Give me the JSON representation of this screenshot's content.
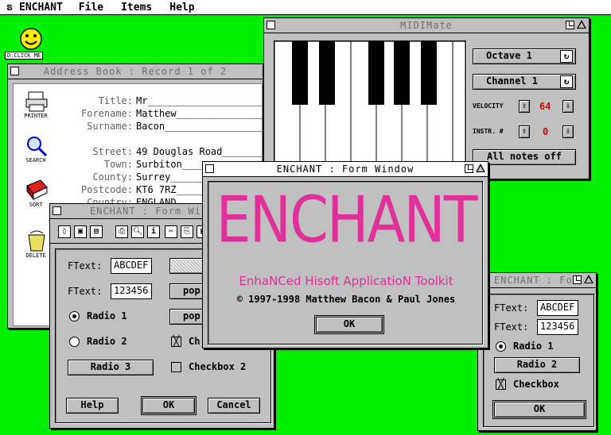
{
  "menubar": {
    "app": "ENCHANT",
    "items": [
      "File",
      "Items",
      "Help"
    ]
  },
  "desktop": {
    "icon_label": "D.CLICK ME"
  },
  "address_book": {
    "title": "Address Book : Record 1 of 2",
    "side_icons": [
      "PRINTER",
      "SEARCH",
      "SORT",
      "DELETE"
    ],
    "fields": [
      {
        "label": "Title:",
        "value": "Mr_______________________"
      },
      {
        "label": "Forename:",
        "value": "Matthew___________________"
      },
      {
        "label": "Surname:",
        "value": "Bacon_____________________"
      },
      {
        "label": "Street:",
        "value": "49 Douglas Road___________"
      },
      {
        "label": "Town:",
        "value": "Surbiton__________________"
      },
      {
        "label": "County:",
        "value": "Surrey____________________"
      },
      {
        "label": "Postcode:",
        "value": "KT6 7RZ___________________"
      },
      {
        "label": "Country:",
        "value": "ENGLAND"
      }
    ]
  },
  "midimate": {
    "title": "MIDIMate",
    "octave_label": "Octave 1",
    "channel_label": "Channel 1",
    "velocity_label": "VELOCITY",
    "velocity_value": "64",
    "instr_label": "INSTR. #",
    "instr_value": "0",
    "all_notes_off": "All notes off",
    "value_color": "#dd0000"
  },
  "form_left": {
    "title": "ENCHANT : Form Window",
    "ftext1_label": "FText:",
    "ftext1_value": "ABCDEF",
    "ftext2_label": "FText:",
    "ftext2_value": "123456",
    "popup1": "pop",
    "popup2": "pop",
    "radio1": "Radio 1",
    "radio2": "Radio 2",
    "radio3": "Radio 3",
    "check1": "Ch",
    "check2": "Checkbox 2",
    "help": "Help",
    "ok": "OK",
    "cancel": "Cancel"
  },
  "form_center": {
    "title": "ENCHANT : Form Window",
    "logo_text": "ENCHANT",
    "tagline": "EnhaNCed Hisoft ApplicatioN Toolkit",
    "copyright": "© 1997-1998 Matthew Bacon & Paul Jones",
    "ok": "OK",
    "accent": "#e0309a"
  },
  "form_right": {
    "title": "ENCHANT : Fo",
    "ftext1_label": "FText:",
    "ftext1_value": "ABCDEF",
    "ftext2_label": "FText:",
    "ftext2_value": "123456",
    "radio1": "Radio 1",
    "radio2": "Radio 2",
    "check": "Checkbox",
    "ok": "OK"
  }
}
